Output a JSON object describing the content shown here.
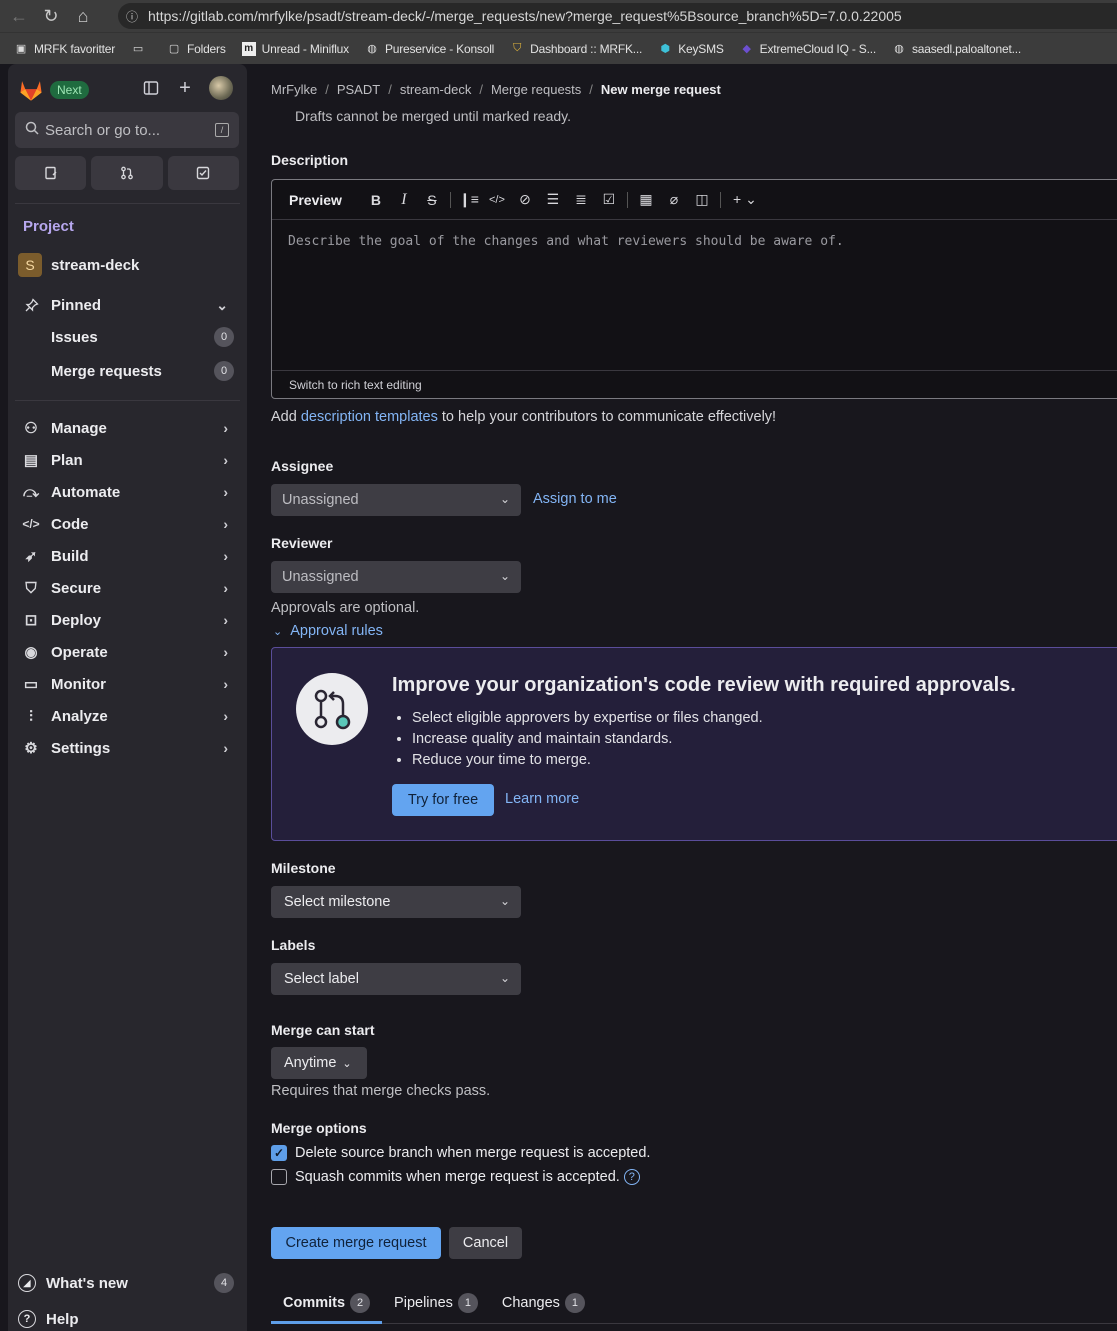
{
  "browser": {
    "url": "https://gitlab.com/mrfylke/psadt/stream-deck/-/merge_requests/new?merge_request%5Bsource_branch%5D=7.0.0.22005",
    "bookmarks": [
      {
        "label": "MRFK favoritter",
        "icon": "bookmark-folder-icon"
      },
      {
        "label": "",
        "icon": "device-icon"
      },
      {
        "label": "Folders",
        "icon": "folder-icon"
      },
      {
        "label": "Unread - Miniflux",
        "icon": "miniflux-icon"
      },
      {
        "label": "Pureservice - Konsoll",
        "icon": "globe-icon"
      },
      {
        "label": "Dashboard :: MRFK...",
        "icon": "shield-icon"
      },
      {
        "label": "KeySMS",
        "icon": "hexagon-icon"
      },
      {
        "label": "ExtremeCloud IQ - S...",
        "icon": "cloud-icon"
      },
      {
        "label": "saasedl.paloaltonet...",
        "icon": "globe-icon"
      }
    ]
  },
  "sidebar": {
    "next_badge": "Next",
    "search_placeholder": "Search or go to...",
    "project_label": "Project",
    "project_initial": "S",
    "project_name": "stream-deck",
    "pinned_label": "Pinned",
    "pinned_items": [
      {
        "label": "Issues",
        "count": "0"
      },
      {
        "label": "Merge requests",
        "count": "0"
      }
    ],
    "nav_items": [
      {
        "label": "Manage",
        "icon": "manage-icon"
      },
      {
        "label": "Plan",
        "icon": "plan-icon"
      },
      {
        "label": "Automate",
        "icon": "automate-icon"
      },
      {
        "label": "Code",
        "icon": "code-icon"
      },
      {
        "label": "Build",
        "icon": "build-icon"
      },
      {
        "label": "Secure",
        "icon": "shield-icon"
      },
      {
        "label": "Deploy",
        "icon": "deploy-icon"
      },
      {
        "label": "Operate",
        "icon": "operate-icon"
      },
      {
        "label": "Monitor",
        "icon": "monitor-icon"
      },
      {
        "label": "Analyze",
        "icon": "chart-icon"
      },
      {
        "label": "Settings",
        "icon": "gear-icon"
      }
    ],
    "whats_new_label": "What's new",
    "whats_new_count": "4",
    "help_label": "Help"
  },
  "breadcrumb": [
    "MrFylke",
    "PSADT",
    "stream-deck",
    "Merge requests",
    "New merge request"
  ],
  "form": {
    "draft_note": "Drafts cannot be merged until marked ready.",
    "description_label": "Description",
    "editor_preview_tab": "Preview",
    "editor_placeholder": "Describe the goal of the changes and what reviewers should be aware of.",
    "editor_footer": "Switch to rich text editing",
    "help_prefix": "Add ",
    "help_link": "description templates",
    "help_suffix": " to help your contributors to communicate effectively!",
    "assignee_label": "Assignee",
    "assignee_value": "Unassigned",
    "assign_to_me": "Assign to me",
    "reviewer_label": "Reviewer",
    "reviewer_value": "Unassigned",
    "approvals_optional": "Approvals are optional.",
    "approval_rules": "Approval rules",
    "promo": {
      "title": "Improve your organization's code review with required approvals.",
      "bullets": [
        "Select eligible approvers by expertise or files changed.",
        "Increase quality and maintain standards.",
        "Reduce your time to merge."
      ],
      "try_button": "Try for free",
      "learn_more": "Learn more"
    },
    "milestone_label": "Milestone",
    "milestone_value": "Select milestone",
    "labels_label": "Labels",
    "labels_value": "Select label",
    "merge_start_label": "Merge can start",
    "merge_start_value": "Anytime",
    "merge_start_note": "Requires that merge checks pass.",
    "merge_options_label": "Merge options",
    "delete_branch_label": "Delete source branch when merge request is accepted.",
    "delete_branch_checked": true,
    "squash_label": "Squash commits when merge request is accepted.",
    "squash_checked": false,
    "create_button": "Create merge request",
    "cancel_button": "Cancel"
  },
  "tabs": [
    {
      "label": "Commits",
      "count": "2",
      "active": true
    },
    {
      "label": "Pipelines",
      "count": "1",
      "active": false
    },
    {
      "label": "Changes",
      "count": "1",
      "active": false
    }
  ],
  "colors": {
    "accent": "#63a4f0",
    "link": "#83b5f5",
    "project_label": "#b7a7ee",
    "promo_bg": "#241f3a",
    "success_badge": "#1f6b3f"
  }
}
